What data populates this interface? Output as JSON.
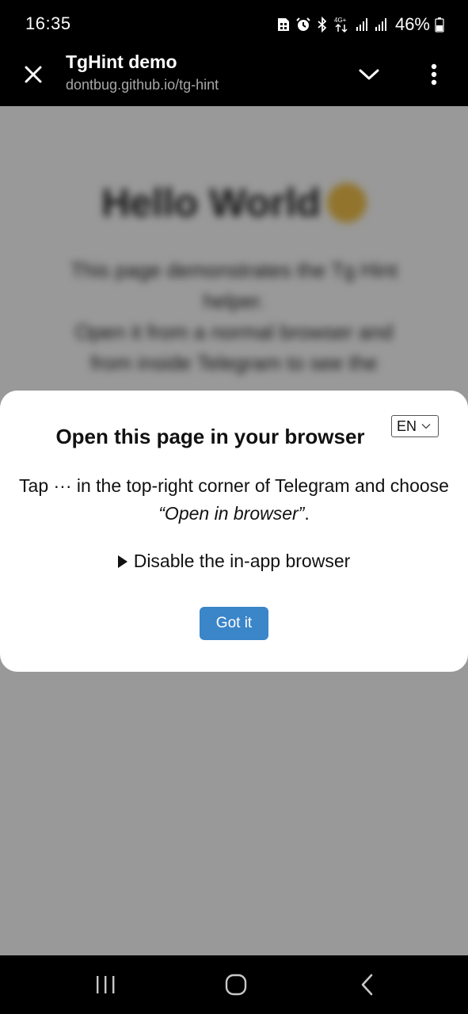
{
  "status_bar": {
    "time": "16:35",
    "network": "4G+",
    "battery": "46%",
    "icons": [
      "sim-icon",
      "alarm-icon",
      "bluetooth-icon",
      "data-4g-icon",
      "signal-icon",
      "signal-icon",
      "battery-icon"
    ]
  },
  "app_bar": {
    "title": "TgHint demo",
    "url": "dontbug.github.io/tg-hint",
    "icons": [
      "close-icon",
      "chevron-down-icon",
      "more-vertical-icon"
    ]
  },
  "page": {
    "heading": "Hello World",
    "heading_emoji_icon": "sun-emoji-icon",
    "text_lines": [
      "This page demonstrates the Tg Hint",
      "helper.",
      "Open it from a normal browser and",
      "from inside Telegram to see the"
    ]
  },
  "modal": {
    "language": "EN",
    "title": "Open this page in your browser",
    "body_before": "Tap ··· in the top-right corner of Telegram and choose ",
    "body_emphasis": "“Open in browser”",
    "body_after": ".",
    "details_label": "Disable the in-app browser",
    "button_label": "Got it",
    "accent_color": "#3b85c9"
  },
  "nav_bar": {
    "icons": [
      "recents-icon",
      "home-icon",
      "back-icon"
    ]
  }
}
